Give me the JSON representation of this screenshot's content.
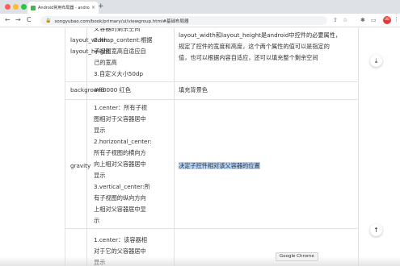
{
  "colors": {
    "close_button": "#ff5f57",
    "minimize_button": "#febc2e",
    "zoom_button": "#28c840",
    "highlight": "#b3d4fc",
    "avatar": "#e53935"
  },
  "browser": {
    "tab_title": "Android常用布局器 - andro…",
    "tab_close": "×",
    "new_tab": "+",
    "back_icon": "←",
    "forward_icon": "→",
    "reload_icon": "C",
    "lock_icon": "🔒",
    "url": "songyubao.com/book/primary/ui/viewgroup.html#基础布局器",
    "share_icon": "⇧",
    "star_icon": "☆",
    "puzzle_icon": "✱",
    "reading_icon": "▭",
    "avatar_label": "UB",
    "menu_icon": "⋮"
  },
  "table": {
    "row_layout": {
      "name": [
        "layout_width",
        "layout_height"
      ],
      "values": [
        "父容器的剩余空间",
        "2.wrap_content:根据",
        "子视图宽高自适应自",
        "己的宽高",
        "3.自定义大小50dp"
      ],
      "description": [
        "layout_width和layout_height是android中控件的必要属性，",
        "规定了控件的宽度和高度，这个两个属性的值可以是指定的",
        "值，也可以根据内容自适应，还可以填充整个剩余空间"
      ]
    },
    "row_background": {
      "name": "background",
      "value": "#ff0000 红色",
      "description": "填充背景色"
    },
    "row_gravity": {
      "name": "gravity",
      "values": [
        "1.center：所有子视",
        "图相对于父容器居中",
        "显示",
        "2.horizontal_center:",
        "所有子视图的横向方",
        "向上相对父容器居中",
        "显示",
        "3.vertical_center:所",
        "有子视图的纵向方向",
        "上相对父容器居中显",
        "示"
      ],
      "description": "决定子控件相对该父容器的位置"
    },
    "row_next": {
      "values": [
        "1.center：该容器相",
        "对于它的父容器居中",
        "显示"
      ]
    }
  },
  "buttons": {
    "download_icon": "⤓",
    "top_icon": "↑"
  },
  "tooltip": "Google Chrome"
}
